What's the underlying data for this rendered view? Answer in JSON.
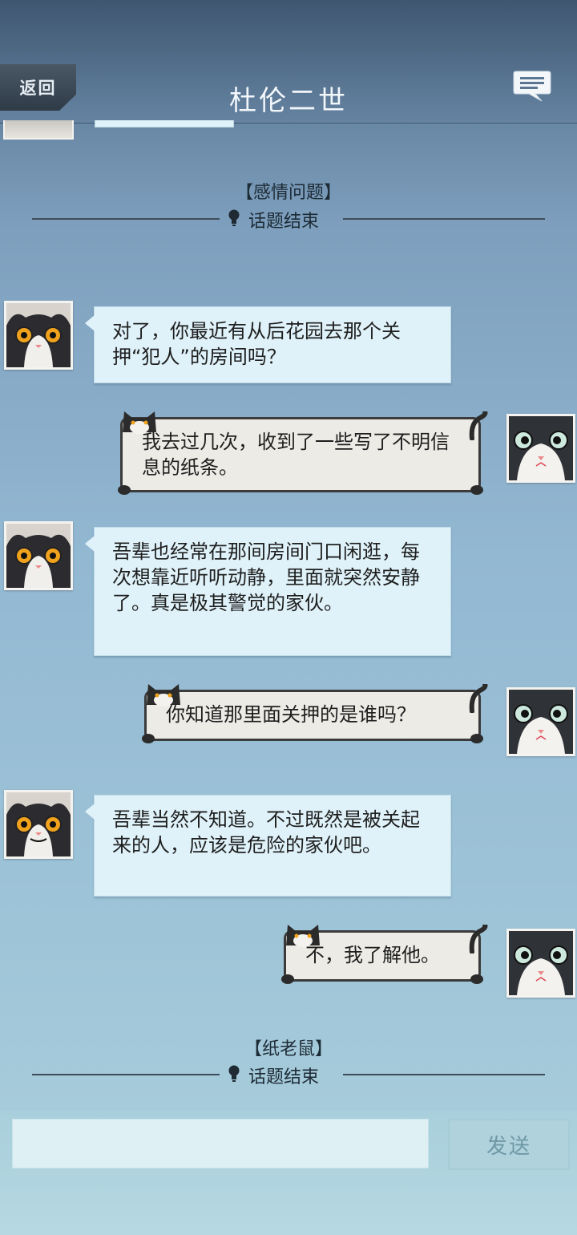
{
  "header": {
    "back_label": "返回",
    "title": "杜伦二世",
    "menu_icon": "chat-bubble-icon"
  },
  "topics": [
    {
      "label": "【感情问题】",
      "end_text": "话题结束"
    },
    {
      "label": "【纸老鼠】",
      "end_text": "话题结束"
    }
  ],
  "messages": [
    {
      "side": "left",
      "text": "对了，你最近有从后花园去那个关押“犯人”的房间吗？"
    },
    {
      "side": "right",
      "text": "我去过几次，收到了一些写了不明信息的纸条。"
    },
    {
      "side": "left",
      "text": "吾辈也经常在那间房间门口闲逛，每次想靠近听听动静，里面就突然安静了。真是极其警觉的家伙。"
    },
    {
      "side": "right",
      "text": "你知道那里面关押的是谁吗？"
    },
    {
      "side": "left",
      "text": "吾辈当然不知道。不过既然是被关起来的人，应该是危险的家伙吧。"
    },
    {
      "side": "right",
      "text": "不，我了解他。"
    }
  ],
  "input": {
    "placeholder": "",
    "send_label": "发送"
  },
  "colors": {
    "left_bubble": "#dff2f9",
    "right_bubble": "#ecebe6",
    "header": "#4f6a86"
  }
}
